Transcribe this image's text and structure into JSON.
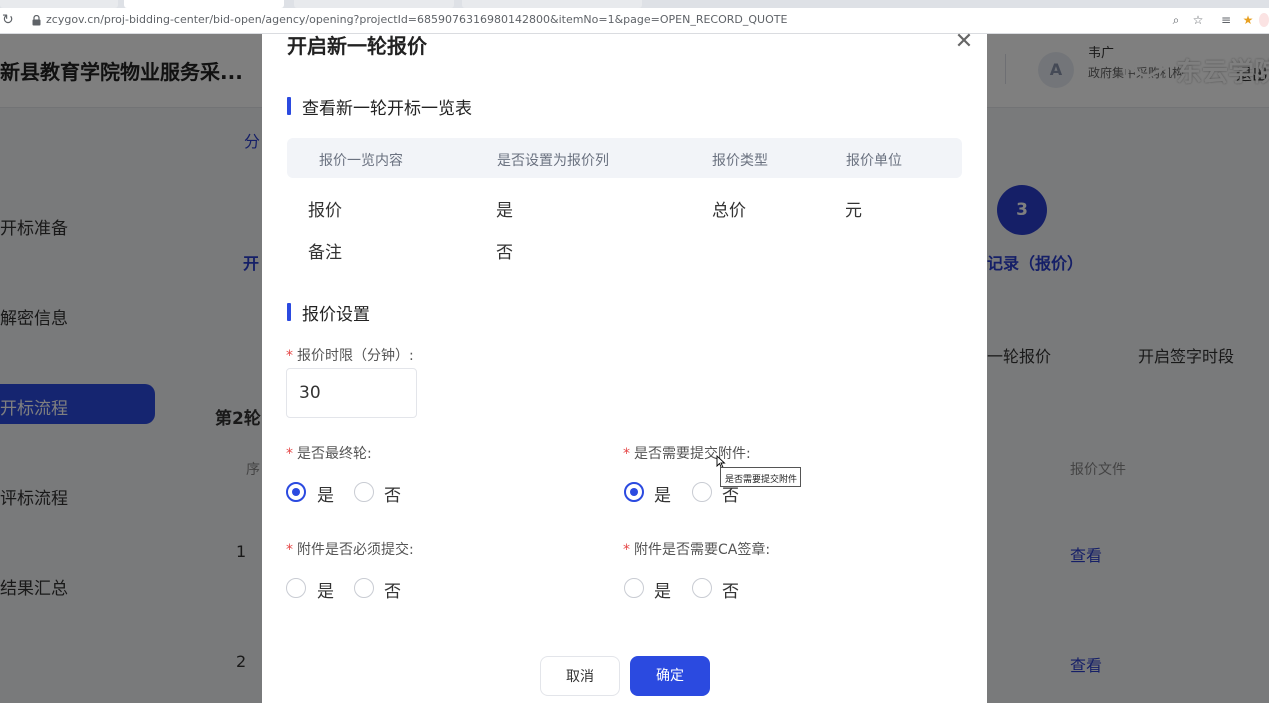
{
  "browser": {
    "url": "zcygov.cn/proj-bidding-center/bid-open/agency/opening?projectId=6859076316980142800&itemNo=1&page=OPEN_RECORD_QUOTE"
  },
  "background": {
    "page_title": "新县教育学院物业服务采...",
    "user_avatar": "A",
    "user_name": "韦广",
    "user_org": "政府集中采购机构",
    "logout": "退出",
    "watermark_text": "东云学院",
    "watermark_sub": "elearning.zcygov.cn",
    "sidebar": [
      "开标准备",
      "解密信息",
      "开标流程",
      "评标流程",
      "结果汇总"
    ],
    "tab_fragment": "分",
    "step_fragment": "开",
    "step_number": "3",
    "step_label": "记录（报价）",
    "action_1": "一轮报价",
    "action_2": "开启签字时段",
    "round_label": "第2轮",
    "col_seq": "序",
    "col_file": "报价文件",
    "rows": [
      {
        "seq": "1",
        "link": "查看"
      },
      {
        "seq": "2",
        "link": "查看"
      }
    ]
  },
  "modal": {
    "title": "开启新一轮报价",
    "section1_title": "查看新一轮开标一览表",
    "table_headers": [
      "报价一览内容",
      "是否设置为报价列",
      "报价类型",
      "报价单位"
    ],
    "table_rows": [
      [
        "报价",
        "是",
        "总价",
        "元"
      ],
      [
        "备注",
        "否",
        "",
        ""
      ]
    ],
    "section2_title": "报价设置",
    "time_limit_label": "报价时限（分钟）:",
    "time_limit_value": "30",
    "final_round_label": "是否最终轮:",
    "need_attachment_label": "是否需要提交附件:",
    "attachment_required_label": "附件是否必须提交:",
    "attachment_ca_label": "附件是否需要CA签章:",
    "yes": "是",
    "no": "否",
    "required_mark": "*",
    "tooltip": "是否需要提交附件",
    "cancel_button": "取消",
    "confirm_button": "确定",
    "final_round_value": "是",
    "need_attachment_value": "是"
  },
  "colors": {
    "primary": "#2b4ae0",
    "required": "#e54545"
  }
}
